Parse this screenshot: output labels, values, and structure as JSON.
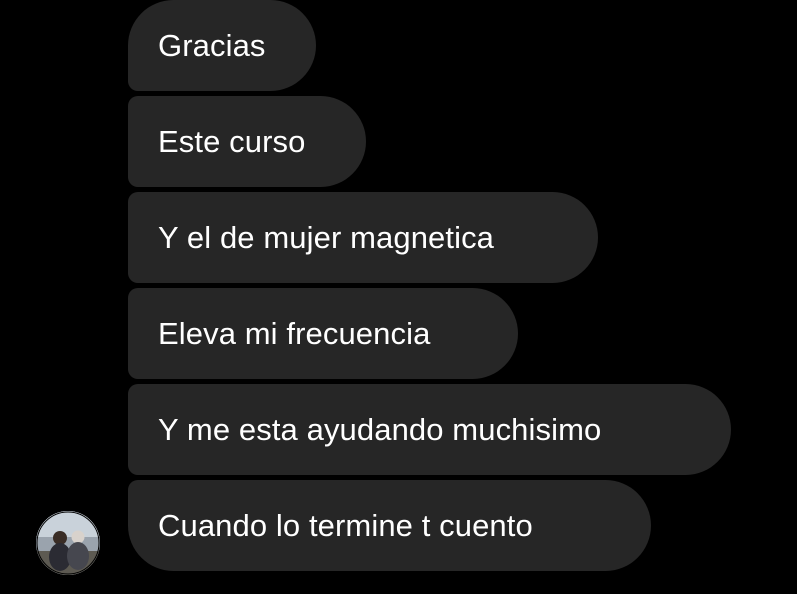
{
  "conversation": {
    "messages": [
      {
        "text": "Gracias"
      },
      {
        "text": "Este curso"
      },
      {
        "text": "Y el de mujer magnetica"
      },
      {
        "text": "Eleva mi frecuencia"
      },
      {
        "text": "Y me esta ayudando muchisimo"
      },
      {
        "text": "Cuando lo termine t cuento"
      }
    ],
    "sender": {
      "avatar_icon": "profile-photo-avatar"
    }
  },
  "colors": {
    "background": "#000000",
    "bubble": "#262626",
    "text": "#ffffff"
  }
}
